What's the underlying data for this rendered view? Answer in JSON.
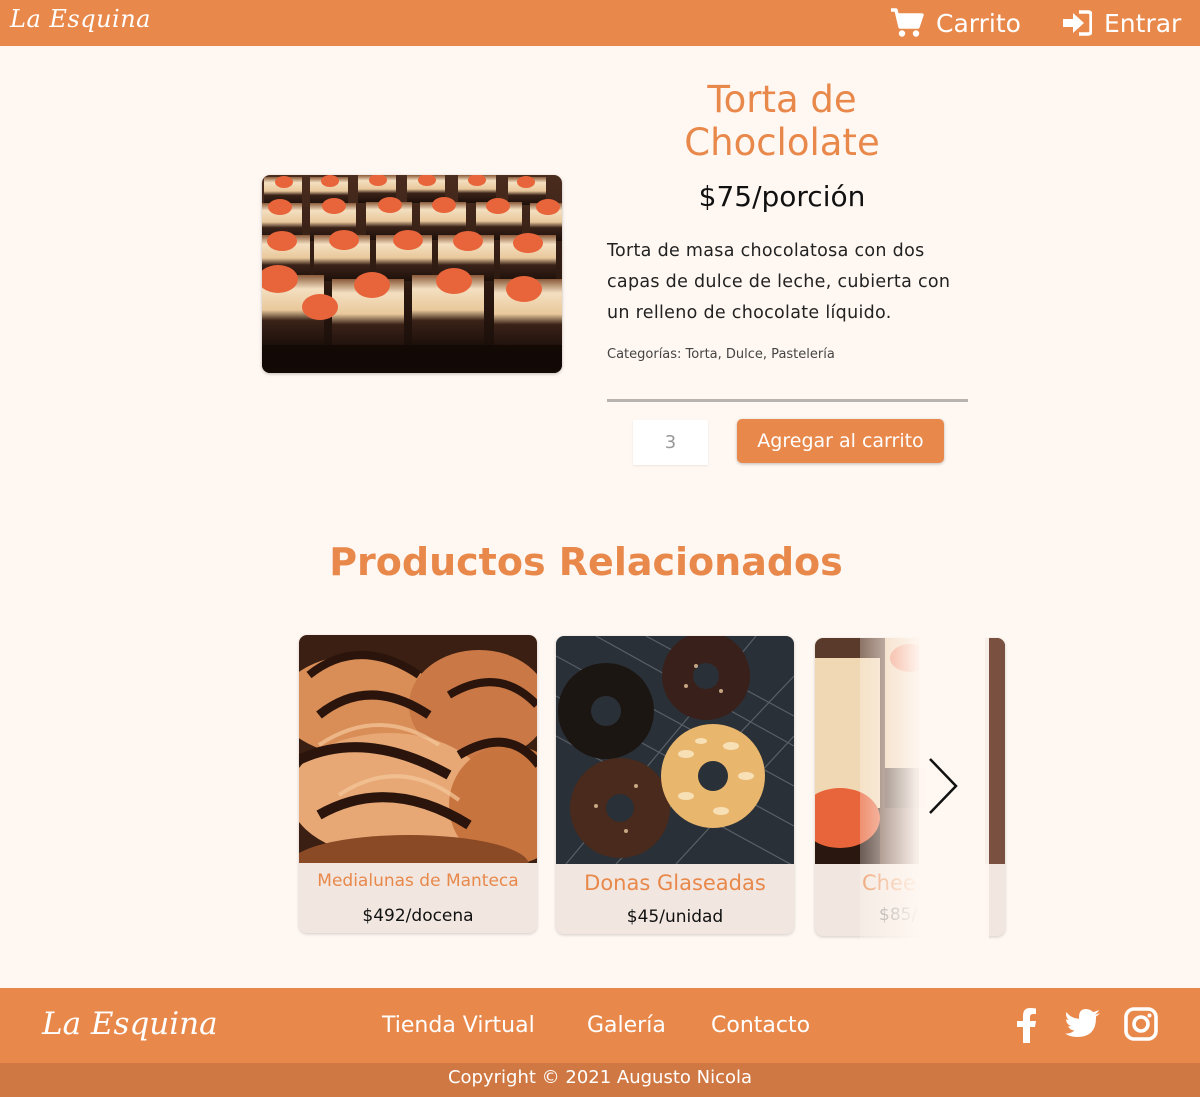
{
  "header": {
    "logo": "La Esquina",
    "cart_label": "Carrito",
    "login_label": "Entrar"
  },
  "product": {
    "title_line1": "Torta de",
    "title_line2": "Choclolate",
    "price": "$75/porción",
    "description": "Torta de masa chocolatosa con dos capas de dulce de leche, cubierta con un relleno de chocolate líquido.",
    "categories": "Categorías: Torta, Dulce, Pastelería",
    "quantity": "3",
    "add_button": "Agregar al carrito"
  },
  "related": {
    "heading": "Productos Relacionados",
    "items": [
      {
        "name": "Medialunas de Manteca",
        "price": "$492/docena"
      },
      {
        "name": "Donas Glaseadas",
        "price": "$45/unidad"
      },
      {
        "name": "Chee",
        "price": "$85/"
      }
    ]
  },
  "footer": {
    "logo": "La Esquina",
    "links": [
      "Tienda Virtual",
      "Galería",
      "Contacto"
    ],
    "copyright": "Copyright © 2021 Augusto Nicola"
  },
  "colors": {
    "brand": "#e8884b",
    "brand_dark": "#cf7843",
    "background": "#fff7f1",
    "card": "#f1e7e0"
  }
}
